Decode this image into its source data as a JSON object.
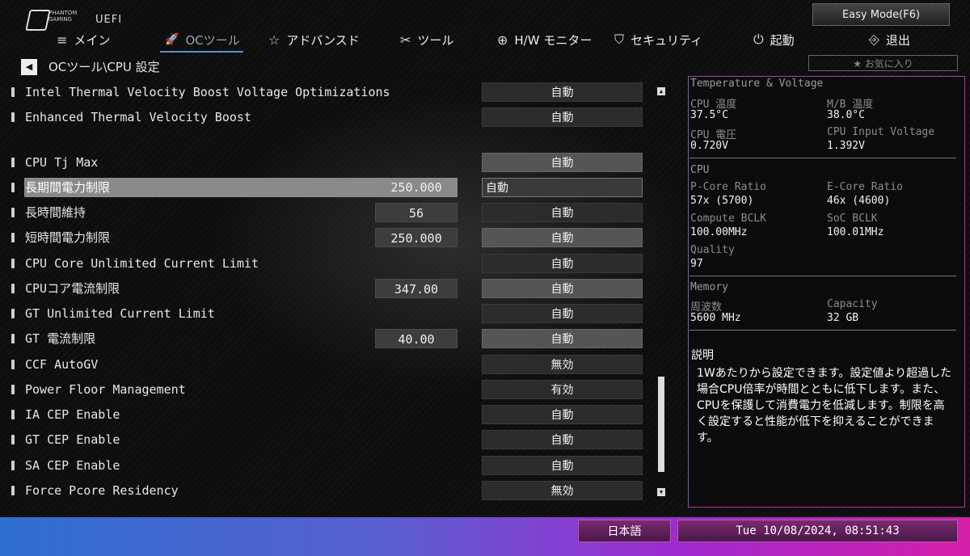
{
  "header": {
    "brand_line1": "PHANTOM",
    "brand_line2": "GAMING",
    "uefi": "UEFI",
    "easy_mode": "Easy Mode(F6)",
    "favorites": "★ お気に入り"
  },
  "menu": [
    {
      "icon": "≡",
      "label": "メイン"
    },
    {
      "icon": "🚀",
      "label": "OCツール",
      "active": true
    },
    {
      "icon": "☆",
      "label": "アドバンスド"
    },
    {
      "icon": "✂",
      "label": "ツール"
    },
    {
      "icon": "⊕",
      "label": "H/W モニター"
    },
    {
      "icon": "⛉",
      "label": "セキュリティ"
    },
    {
      "icon": "⏻",
      "label": "起動"
    },
    {
      "icon": "⎆",
      "label": "退出"
    }
  ],
  "breadcrumb": "OCツール\\CPU 設定",
  "settings": [
    {
      "label": "Intel Thermal Velocity Boost Voltage Optimizations",
      "value": "",
      "option": "自動"
    },
    {
      "label": "Enhanced Thermal Velocity Boost",
      "value": "",
      "option": "自動"
    },
    {
      "label": "CPU Tj Max",
      "value": "",
      "option": "自動"
    },
    {
      "label": "長期間電力制限",
      "value": "250.000",
      "option": "自動"
    },
    {
      "label": "長時間維持",
      "value": "56",
      "option": "自動"
    },
    {
      "label": "短時間電力制限",
      "value": "250.000",
      "option": "自動"
    },
    {
      "label": "CPU Core Unlimited Current Limit",
      "value": "",
      "option": "自動"
    },
    {
      "label": "CPUコア電流制限",
      "value": "347.00",
      "option": "自動"
    },
    {
      "label": "GT Unlimited Current Limit",
      "value": "",
      "option": "自動"
    },
    {
      "label": "GT 電流制限",
      "value": "40.00",
      "option": "自動"
    },
    {
      "label": "CCF AutoGV",
      "value": "",
      "option": "無効"
    },
    {
      "label": "Power Floor Management",
      "value": "",
      "option": "有効"
    },
    {
      "label": "IA CEP Enable",
      "value": "",
      "option": "自動"
    },
    {
      "label": "GT CEP Enable",
      "value": "",
      "option": "自動"
    },
    {
      "label": "SA CEP Enable",
      "value": "",
      "option": "自動"
    },
    {
      "label": "Force Pcore Residency",
      "value": "",
      "option": "無効"
    }
  ],
  "panel": {
    "tv_title": "Temperature & Voltage",
    "cpu_temp_label": "CPU 温度",
    "cpu_temp": "37.5°C",
    "mb_temp_label": "M/B 温度",
    "mb_temp": "38.0°C",
    "cpu_volt_label": "CPU 電圧",
    "cpu_volt": "0.720V",
    "cpu_input_label": "CPU Input Voltage",
    "cpu_input": "1.392V",
    "cpu_title": "CPU",
    "pcore_label": "P-Core Ratio",
    "pcore": "57x (5700)",
    "ecore_label": "E-Core Ratio",
    "ecore": "46x (4600)",
    "bclk_label": "Compute BCLK",
    "bclk": "100.00MHz",
    "soc_label": "SoC BCLK",
    "soc": "100.01MHz",
    "quality_label": "Quality",
    "quality": "97",
    "mem_title": "Memory",
    "freq_label": "周波数",
    "freq": "5600 MHz",
    "cap_label": "Capacity",
    "cap": "32 GB",
    "desc_title": "説明",
    "desc": " 1Wあたりから設定できます。設定値より超過した場合CPU倍率が時間とともに低下します。また、CPUを保護して消費電力を低減します。制限を高く設定すると性能が低下を抑えることができます。"
  },
  "footer": {
    "language": "日本語",
    "datetime": "Tue 10/08/2024, 08:51:43"
  }
}
